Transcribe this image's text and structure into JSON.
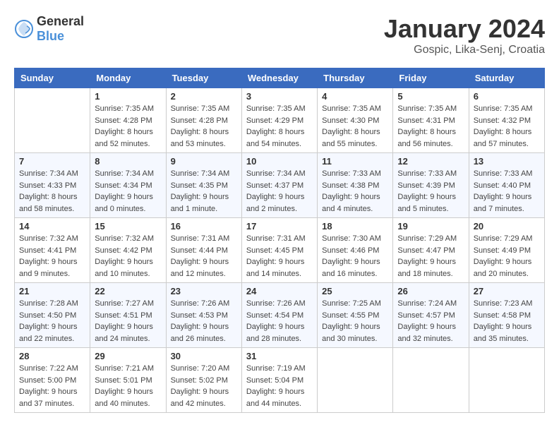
{
  "header": {
    "logo_general": "General",
    "logo_blue": "Blue",
    "title": "January 2024",
    "location": "Gospic, Lika-Senj, Croatia"
  },
  "weekdays": [
    "Sunday",
    "Monday",
    "Tuesday",
    "Wednesday",
    "Thursday",
    "Friday",
    "Saturday"
  ],
  "weeks": [
    [
      {
        "day": "",
        "sunrise": "",
        "sunset": "",
        "daylight": ""
      },
      {
        "day": "1",
        "sunrise": "Sunrise: 7:35 AM",
        "sunset": "Sunset: 4:28 PM",
        "daylight": "Daylight: 8 hours and 52 minutes."
      },
      {
        "day": "2",
        "sunrise": "Sunrise: 7:35 AM",
        "sunset": "Sunset: 4:28 PM",
        "daylight": "Daylight: 8 hours and 53 minutes."
      },
      {
        "day": "3",
        "sunrise": "Sunrise: 7:35 AM",
        "sunset": "Sunset: 4:29 PM",
        "daylight": "Daylight: 8 hours and 54 minutes."
      },
      {
        "day": "4",
        "sunrise": "Sunrise: 7:35 AM",
        "sunset": "Sunset: 4:30 PM",
        "daylight": "Daylight: 8 hours and 55 minutes."
      },
      {
        "day": "5",
        "sunrise": "Sunrise: 7:35 AM",
        "sunset": "Sunset: 4:31 PM",
        "daylight": "Daylight: 8 hours and 56 minutes."
      },
      {
        "day": "6",
        "sunrise": "Sunrise: 7:35 AM",
        "sunset": "Sunset: 4:32 PM",
        "daylight": "Daylight: 8 hours and 57 minutes."
      }
    ],
    [
      {
        "day": "7",
        "sunrise": "Sunrise: 7:34 AM",
        "sunset": "Sunset: 4:33 PM",
        "daylight": "Daylight: 8 hours and 58 minutes."
      },
      {
        "day": "8",
        "sunrise": "Sunrise: 7:34 AM",
        "sunset": "Sunset: 4:34 PM",
        "daylight": "Daylight: 9 hours and 0 minutes."
      },
      {
        "day": "9",
        "sunrise": "Sunrise: 7:34 AM",
        "sunset": "Sunset: 4:35 PM",
        "daylight": "Daylight: 9 hours and 1 minute."
      },
      {
        "day": "10",
        "sunrise": "Sunrise: 7:34 AM",
        "sunset": "Sunset: 4:37 PM",
        "daylight": "Daylight: 9 hours and 2 minutes."
      },
      {
        "day": "11",
        "sunrise": "Sunrise: 7:33 AM",
        "sunset": "Sunset: 4:38 PM",
        "daylight": "Daylight: 9 hours and 4 minutes."
      },
      {
        "day": "12",
        "sunrise": "Sunrise: 7:33 AM",
        "sunset": "Sunset: 4:39 PM",
        "daylight": "Daylight: 9 hours and 5 minutes."
      },
      {
        "day": "13",
        "sunrise": "Sunrise: 7:33 AM",
        "sunset": "Sunset: 4:40 PM",
        "daylight": "Daylight: 9 hours and 7 minutes."
      }
    ],
    [
      {
        "day": "14",
        "sunrise": "Sunrise: 7:32 AM",
        "sunset": "Sunset: 4:41 PM",
        "daylight": "Daylight: 9 hours and 9 minutes."
      },
      {
        "day": "15",
        "sunrise": "Sunrise: 7:32 AM",
        "sunset": "Sunset: 4:42 PM",
        "daylight": "Daylight: 9 hours and 10 minutes."
      },
      {
        "day": "16",
        "sunrise": "Sunrise: 7:31 AM",
        "sunset": "Sunset: 4:44 PM",
        "daylight": "Daylight: 9 hours and 12 minutes."
      },
      {
        "day": "17",
        "sunrise": "Sunrise: 7:31 AM",
        "sunset": "Sunset: 4:45 PM",
        "daylight": "Daylight: 9 hours and 14 minutes."
      },
      {
        "day": "18",
        "sunrise": "Sunrise: 7:30 AM",
        "sunset": "Sunset: 4:46 PM",
        "daylight": "Daylight: 9 hours and 16 minutes."
      },
      {
        "day": "19",
        "sunrise": "Sunrise: 7:29 AM",
        "sunset": "Sunset: 4:47 PM",
        "daylight": "Daylight: 9 hours and 18 minutes."
      },
      {
        "day": "20",
        "sunrise": "Sunrise: 7:29 AM",
        "sunset": "Sunset: 4:49 PM",
        "daylight": "Daylight: 9 hours and 20 minutes."
      }
    ],
    [
      {
        "day": "21",
        "sunrise": "Sunrise: 7:28 AM",
        "sunset": "Sunset: 4:50 PM",
        "daylight": "Daylight: 9 hours and 22 minutes."
      },
      {
        "day": "22",
        "sunrise": "Sunrise: 7:27 AM",
        "sunset": "Sunset: 4:51 PM",
        "daylight": "Daylight: 9 hours and 24 minutes."
      },
      {
        "day": "23",
        "sunrise": "Sunrise: 7:26 AM",
        "sunset": "Sunset: 4:53 PM",
        "daylight": "Daylight: 9 hours and 26 minutes."
      },
      {
        "day": "24",
        "sunrise": "Sunrise: 7:26 AM",
        "sunset": "Sunset: 4:54 PM",
        "daylight": "Daylight: 9 hours and 28 minutes."
      },
      {
        "day": "25",
        "sunrise": "Sunrise: 7:25 AM",
        "sunset": "Sunset: 4:55 PM",
        "daylight": "Daylight: 9 hours and 30 minutes."
      },
      {
        "day": "26",
        "sunrise": "Sunrise: 7:24 AM",
        "sunset": "Sunset: 4:57 PM",
        "daylight": "Daylight: 9 hours and 32 minutes."
      },
      {
        "day": "27",
        "sunrise": "Sunrise: 7:23 AM",
        "sunset": "Sunset: 4:58 PM",
        "daylight": "Daylight: 9 hours and 35 minutes."
      }
    ],
    [
      {
        "day": "28",
        "sunrise": "Sunrise: 7:22 AM",
        "sunset": "Sunset: 5:00 PM",
        "daylight": "Daylight: 9 hours and 37 minutes."
      },
      {
        "day": "29",
        "sunrise": "Sunrise: 7:21 AM",
        "sunset": "Sunset: 5:01 PM",
        "daylight": "Daylight: 9 hours and 40 minutes."
      },
      {
        "day": "30",
        "sunrise": "Sunrise: 7:20 AM",
        "sunset": "Sunset: 5:02 PM",
        "daylight": "Daylight: 9 hours and 42 minutes."
      },
      {
        "day": "31",
        "sunrise": "Sunrise: 7:19 AM",
        "sunset": "Sunset: 5:04 PM",
        "daylight": "Daylight: 9 hours and 44 minutes."
      },
      {
        "day": "",
        "sunrise": "",
        "sunset": "",
        "daylight": ""
      },
      {
        "day": "",
        "sunrise": "",
        "sunset": "",
        "daylight": ""
      },
      {
        "day": "",
        "sunrise": "",
        "sunset": "",
        "daylight": ""
      }
    ]
  ]
}
